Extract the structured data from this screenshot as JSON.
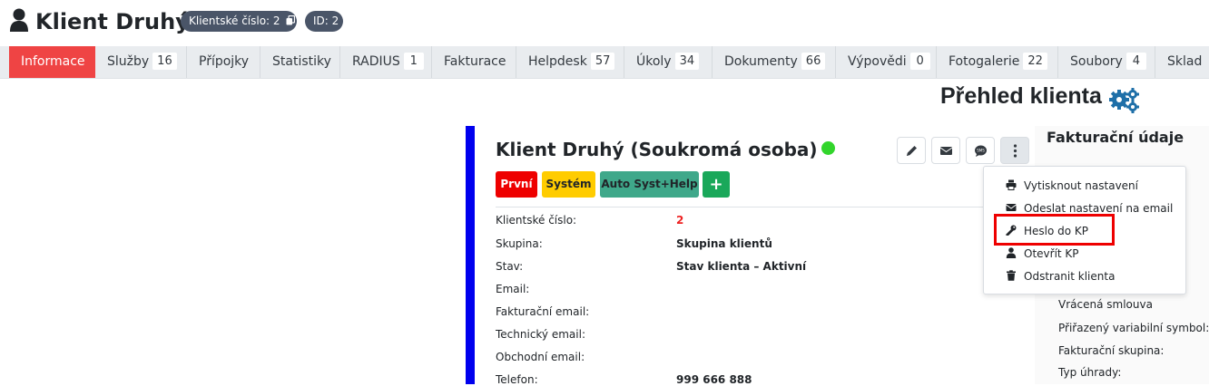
{
  "header": {
    "title": "Klient Druhý",
    "client_number_badge": "Klientské číslo: 2",
    "id_badge": "ID: 2"
  },
  "tabs": [
    {
      "label": "Informace",
      "count": null,
      "active": true
    },
    {
      "label": "Služby",
      "count": "16"
    },
    {
      "label": "Přípojky",
      "count": null
    },
    {
      "label": "Statistiky",
      "count": null
    },
    {
      "label": "RADIUS",
      "count": "1"
    },
    {
      "label": "Fakturace",
      "count": null
    },
    {
      "label": "Helpdesk",
      "count": "57"
    },
    {
      "label": "Úkoly",
      "count": "34"
    },
    {
      "label": "Dokumenty",
      "count": "66"
    },
    {
      "label": "Výpovědi",
      "count": "0"
    },
    {
      "label": "Fotogalerie",
      "count": "22"
    },
    {
      "label": "Soubory",
      "count": "4"
    },
    {
      "label": "Sklad",
      "count": null
    }
  ],
  "overview": {
    "title": "Přehled klienta"
  },
  "card": {
    "title": "Klient Druhý (Soukromá osoba)",
    "status_color": "#32d52c",
    "tags": {
      "prvni": "První",
      "system": "Systém",
      "auto": "Auto Syst+Help",
      "add": "+"
    },
    "rows": [
      {
        "label": "Klientské číslo:",
        "value": "2"
      },
      {
        "label": "Skupina:",
        "value": "Skupina klientů"
      },
      {
        "label": "Stav:",
        "value": "Stav klienta – Aktivní"
      },
      {
        "label": "Email:",
        "value": ""
      },
      {
        "label": "Fakturační email:",
        "value": ""
      },
      {
        "label": "Technický email:",
        "value": ""
      },
      {
        "label": "Obchodní email:",
        "value": ""
      },
      {
        "label": "Telefon:",
        "value": "999 666 888"
      }
    ]
  },
  "billing": {
    "title": "Fakturační údaje",
    "labels": [
      "Vrácená smlouva",
      "Přiřazený variabilní symbol:",
      "Fakturační skupina:",
      "Typ úhrady:"
    ]
  },
  "dropdown": {
    "items": [
      {
        "label": "Vytisknout nastavení",
        "icon": "print-icon"
      },
      {
        "label": "Odeslat nastavení na email",
        "icon": "envelope-icon"
      },
      {
        "label": "Heslo do KP",
        "icon": "key-icon"
      },
      {
        "label": "Otevřít KP",
        "icon": "user-icon"
      },
      {
        "label": "Odstranit klienta",
        "icon": "trash-icon"
      }
    ]
  },
  "colors": {
    "active_tab": "#ef4444",
    "card_border": "#0000ee",
    "highlight": "#ee0000",
    "tag_red": "#ee0000",
    "tag_yellow": "#ffcc00",
    "tag_teal": "#3fa88a",
    "tag_green": "#1aa85a"
  }
}
